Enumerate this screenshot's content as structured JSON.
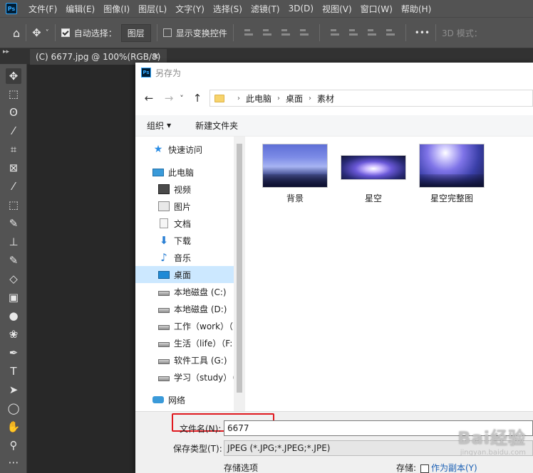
{
  "menubar": {
    "logo": "Ps",
    "items": [
      "文件(F)",
      "编辑(E)",
      "图像(I)",
      "图层(L)",
      "文字(Y)",
      "选择(S)",
      "滤镜(T)",
      "3D(D)",
      "视图(V)",
      "窗口(W)",
      "帮助(H)"
    ]
  },
  "options": {
    "auto_select_label": "自动选择：",
    "auto_select_value": "图层",
    "show_transform_label": "显示变换控件",
    "more": "•••",
    "mode_3d_label": "3D 模式："
  },
  "tabs": {
    "collapse": "▸▸",
    "doc_tab_label": "(C) 6677.jpg @ 100%(RGB/8)",
    "close": "×"
  },
  "dialog": {
    "title": "另存为",
    "title_logo": "Ps",
    "nav": {
      "back": "←",
      "forward": "→",
      "dropdown": "˅",
      "up": "↑"
    },
    "breadcrumbs": [
      "此电脑",
      "桌面",
      "素材"
    ],
    "breadcrumb_sep": "›",
    "commands": {
      "organize": "组织",
      "organize_arrow": "▼",
      "new_folder": "新建文件夹"
    },
    "nav_pane": [
      {
        "label": "快速访问",
        "icon": "star-icon"
      },
      {
        "label": "此电脑",
        "icon": "computer-icon"
      },
      {
        "label": "视频",
        "icon": "video-icon"
      },
      {
        "label": "图片",
        "icon": "pictures-icon"
      },
      {
        "label": "文档",
        "icon": "document-icon"
      },
      {
        "label": "下载",
        "icon": "download-icon"
      },
      {
        "label": "音乐",
        "icon": "music-icon"
      },
      {
        "label": "桌面",
        "icon": "desktop-icon",
        "selected": true
      },
      {
        "label": "本地磁盘 (C:)",
        "icon": "drive-icon"
      },
      {
        "label": "本地磁盘 (D:)",
        "icon": "drive-icon"
      },
      {
        "label": "工作（work）（",
        "icon": "drive-icon"
      },
      {
        "label": "生活（life）（F:",
        "icon": "drive-icon"
      },
      {
        "label": "软件工具 (G:)",
        "icon": "drive-icon"
      },
      {
        "label": "学习（study）（",
        "icon": "drive-icon"
      },
      {
        "label": "网络",
        "icon": "network-icon"
      }
    ],
    "files": [
      {
        "name": "背景"
      },
      {
        "name": "星空"
      },
      {
        "name": "星空完整图"
      }
    ],
    "filename_label": "文件名(N):",
    "filename_value": "6677",
    "filetype_label": "保存类型(T):",
    "filetype_value": "JPEG (*.JPG;*.JPEG;*.JPE)",
    "storage_options_label": "存储选项",
    "storage_label": "存储:",
    "save_as_copy_label": "作为副本(Y)"
  },
  "watermark": {
    "main": "Bai经验",
    "sub": "jingyan.baidu.com"
  },
  "colors": {
    "ps_chrome": "#535353",
    "canvas": "#282828",
    "selection": "#cce8ff",
    "highlight_box": "#e0191f"
  }
}
